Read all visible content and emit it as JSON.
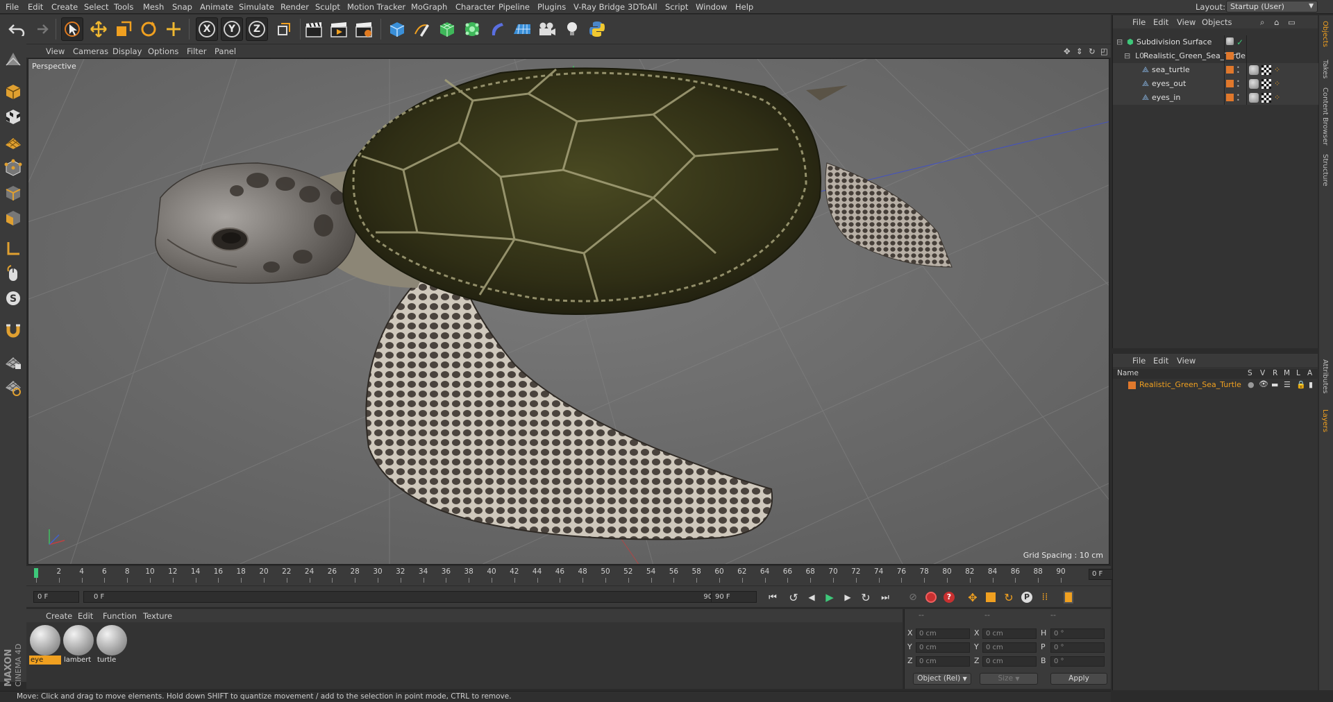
{
  "menubar": {
    "items": [
      "File",
      "Edit",
      "Create",
      "Select",
      "Tools",
      "Mesh",
      "Snap",
      "Animate",
      "Simulate",
      "Render",
      "Sculpt",
      "Motion Tracker",
      "MoGraph",
      "Character",
      "Pipeline",
      "Plugins",
      "V-Ray Bridge",
      "3DToAll",
      "Script",
      "Window",
      "Help"
    ],
    "layout_label": "Layout:",
    "layout_value": "Startup (User)"
  },
  "toolbar": {
    "axis_x": "X",
    "axis_y": "Y",
    "axis_z": "Z"
  },
  "viewport": {
    "menu": [
      "View",
      "Cameras",
      "Display",
      "Options",
      "Filter",
      "Panel"
    ],
    "label": "Perspective",
    "grid_spacing": "Grid Spacing : 10 cm"
  },
  "timeline": {
    "ticks": [
      "0",
      "2",
      "4",
      "6",
      "8",
      "10",
      "12",
      "14",
      "16",
      "18",
      "20",
      "22",
      "24",
      "26",
      "28",
      "30",
      "32",
      "34",
      "36",
      "38",
      "40",
      "42",
      "44",
      "46",
      "48",
      "50",
      "52",
      "54",
      "56",
      "58",
      "60",
      "62",
      "64",
      "66",
      "68",
      "70",
      "72",
      "74",
      "76",
      "78",
      "80",
      "82",
      "84",
      "86",
      "88",
      "90"
    ],
    "current_frame": "0 F"
  },
  "playback": {
    "start_field": "0 F",
    "range_start": "0 F",
    "range_end": "90 F",
    "end_field": "90 F"
  },
  "materials": {
    "menu": [
      "Create",
      "Edit",
      "Function",
      "Texture"
    ],
    "items": [
      {
        "name": "eye",
        "active": true
      },
      {
        "name": "lambert",
        "active": false
      },
      {
        "name": "turtle",
        "active": false
      }
    ]
  },
  "coords": {
    "header": [
      "--",
      "--",
      "--"
    ],
    "pos_labels": [
      "X",
      "Y",
      "Z"
    ],
    "pos_values": [
      "0 cm",
      "0 cm",
      "0 cm"
    ],
    "size_labels": [
      "X",
      "Y",
      "Z"
    ],
    "size_values": [
      "0 cm",
      "0 cm",
      "0 cm"
    ],
    "rot_labels": [
      "H",
      "P",
      "B"
    ],
    "rot_values": [
      "0 °",
      "0 °",
      "0 °"
    ],
    "mode_select": "Object (Rel)",
    "size_select": "Size",
    "apply_label": "Apply"
  },
  "status": {
    "text": "Move: Click and drag to move elements. Hold down SHIFT to quantize movement / add to the selection in point mode, CTRL to remove."
  },
  "objects_panel": {
    "menu": [
      "File",
      "Edit",
      "View",
      "Objects"
    ],
    "rows": [
      {
        "name": "Subdivision Surface",
        "level": 0
      },
      {
        "name": "Realistic_Green_Sea_Turtle",
        "level": 1
      },
      {
        "name": "sea_turtle",
        "level": 2
      },
      {
        "name": "eyes_out",
        "level": 2
      },
      {
        "name": "eyes_in",
        "level": 2
      }
    ]
  },
  "layers_panel": {
    "menu": [
      "File",
      "Edit",
      "View"
    ],
    "columns": [
      "Name",
      "S",
      "V",
      "R",
      "M",
      "L",
      "A"
    ],
    "row_name": "Realistic_Green_Sea_Turtle"
  },
  "right_tabs": [
    "Objects",
    "Takes",
    "Content Browser",
    "Structure",
    "Attributes",
    "Layers"
  ],
  "colors": {
    "accent": "#f0a020",
    "tag_orange": "#e0782c",
    "viewport_bg": "#6b6b6b"
  },
  "brand": {
    "maxon": "MAXON",
    "cinema": "CINEMA 4D"
  }
}
